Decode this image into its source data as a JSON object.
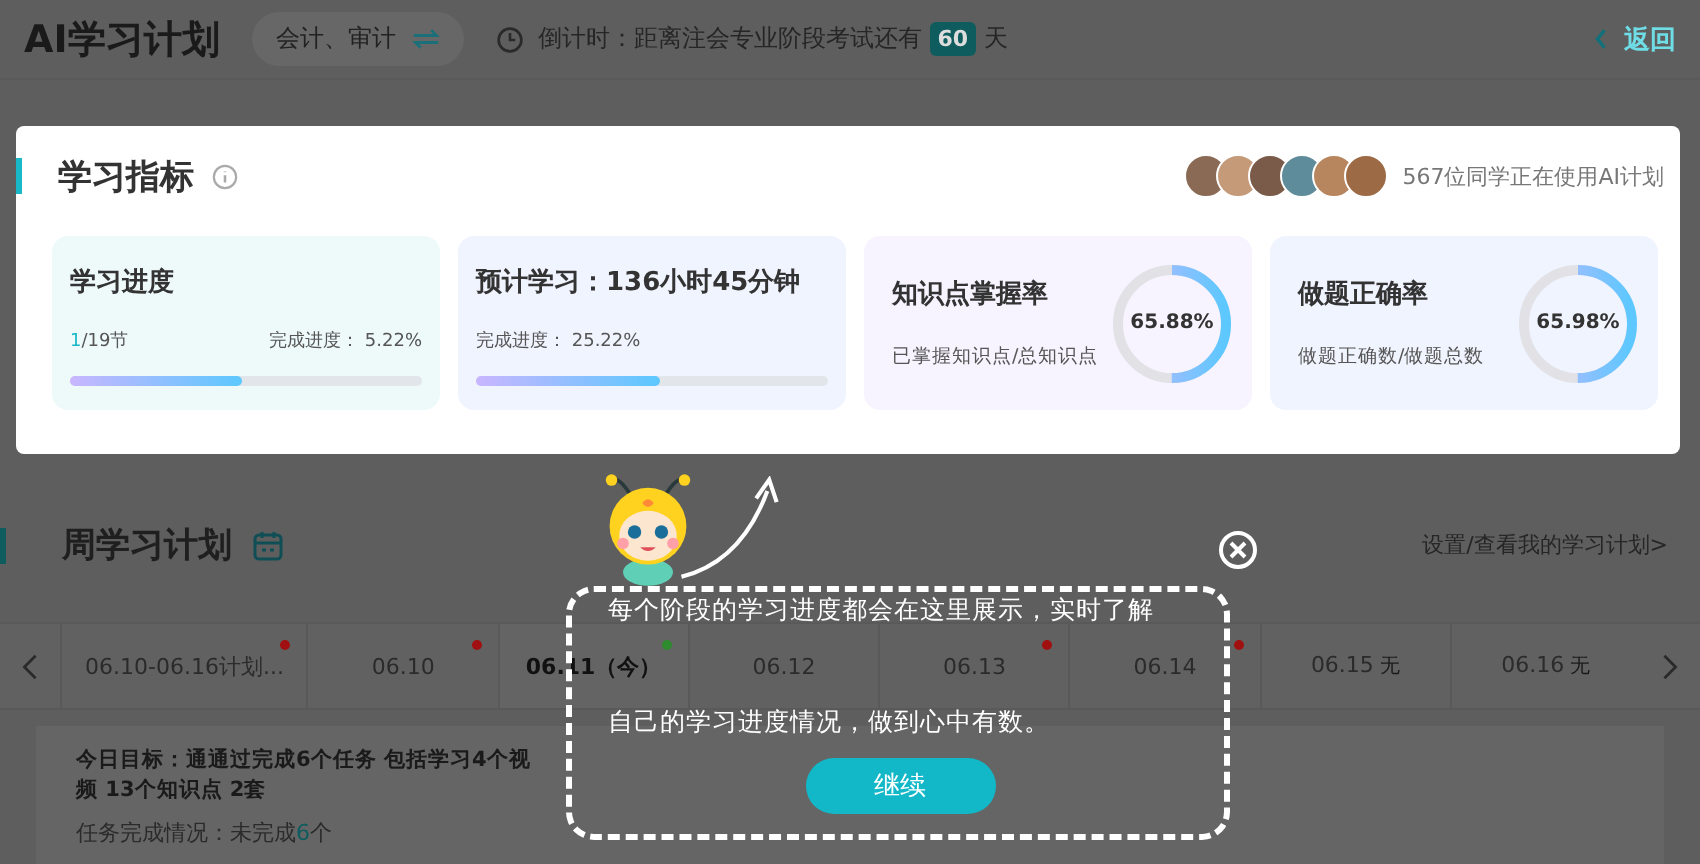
{
  "header": {
    "title": "AI学习计划",
    "subject": "会计、审计",
    "countdown_label": "倒计时：距离注会专业阶段考试还有",
    "countdown_days": "60",
    "countdown_unit": "天",
    "back": "返回"
  },
  "metrics": {
    "title": "学习指标",
    "users_text": "567位同学正在使用AI计划",
    "cards": [
      {
        "kind": "bar",
        "title": "学习进度",
        "count_done": "1",
        "count_rest": "/19节",
        "progress_text": "完成进度： 5.22%",
        "level": 0.49
      },
      {
        "kind": "bar",
        "title": "预计学习：136小时45分钟",
        "progress_text": "完成进度： 25.22%",
        "level": 0.52
      },
      {
        "kind": "ring",
        "title": "知识点掌握率",
        "subtitle": "已掌握知识点/总知识点",
        "percent": "65.88%",
        "level": 0.5
      },
      {
        "kind": "ring",
        "title": "做题正确率",
        "subtitle": "做题正确数/做题总数",
        "percent": "65.98%",
        "level": 0.5
      }
    ]
  },
  "weekly": {
    "title": "周学习计划",
    "link": "设置/查看我的学习计划>",
    "days": [
      {
        "label": "06.10-06.16计划...",
        "selected": false,
        "color": "#a01010"
      },
      {
        "label": "06.10",
        "selected": false,
        "color": "#a01010"
      },
      {
        "label": "06.11（今）",
        "selected": true,
        "color": "#2e8b2e"
      },
      {
        "label": "06.12",
        "selected": false
      },
      {
        "label": "06.13",
        "selected": false,
        "color": "#a01010"
      },
      {
        "label": "06.14",
        "selected": false,
        "color": "#a01010"
      },
      {
        "label": "06.15",
        "selected": false,
        "note": "无"
      },
      {
        "label": "06.16",
        "selected": false,
        "note": "无"
      }
    ],
    "goal": "今日目标：通通过完成6个任务 包括学习4个视频  13个知识点  2套",
    "status_label": "任务完成情况：未完成",
    "status_count": "6",
    "status_unit": "个"
  },
  "guide": {
    "lines": [
      "每个阶段的学习进度都会在这里展示，实时了解",
      "自己的学习进度情况，做到心中有数。"
    ],
    "button": "继续"
  }
}
